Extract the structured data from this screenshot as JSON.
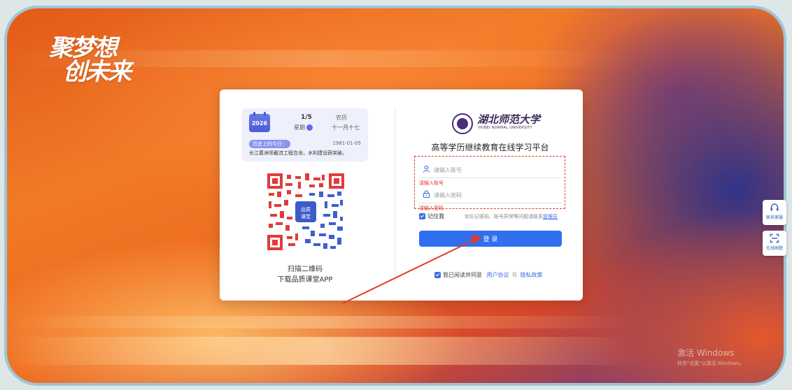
{
  "background": {
    "slogan_line1": "聚梦想",
    "slogan_line2": "创未来"
  },
  "calendar": {
    "year": "2026",
    "date": "1/5",
    "weekday": "星期",
    "lunar_title": "农历",
    "lunar_date": "十一月十七",
    "history_tag": "历史上的今日：",
    "history_date": "1981-01-05",
    "history_text": "长江葛洲坝截流工程合龙，水利建设获突破。"
  },
  "qr": {
    "center_label_1": "品质",
    "center_label_2": "课堂",
    "caption_line1": "扫描二维码",
    "caption_line2": "下载品质课堂APP"
  },
  "login": {
    "university_name": "湖北师范大学",
    "university_en": "HUBEI NORMAL UNIVERSITY",
    "platform_title": "高等学历继续教育在线学习平台",
    "account_placeholder": "请输入账号",
    "account_value": "",
    "account_error": "请输入账号",
    "password_placeholder": "请输入密码",
    "password_value": "",
    "password_error": "请输入密码",
    "remember_label": "记住我",
    "forgot_text": "如忘记密码、账号异常等问题请联系",
    "admin_link": "管理员",
    "submit_label": "登 录",
    "agree_text": "我已阅读并同意",
    "user_agreement": "用户协议",
    "and_text": "与",
    "privacy_policy": "隐私政策",
    "accent_color": "#2f6ff0",
    "error_color": "#e03a2a"
  },
  "side": {
    "contact_label": "联系客服",
    "scan_label": "在线刷题"
  },
  "watermark": {
    "line1": "激活 Windows",
    "line2": "转到\"设置\"以激活 Windows。"
  }
}
